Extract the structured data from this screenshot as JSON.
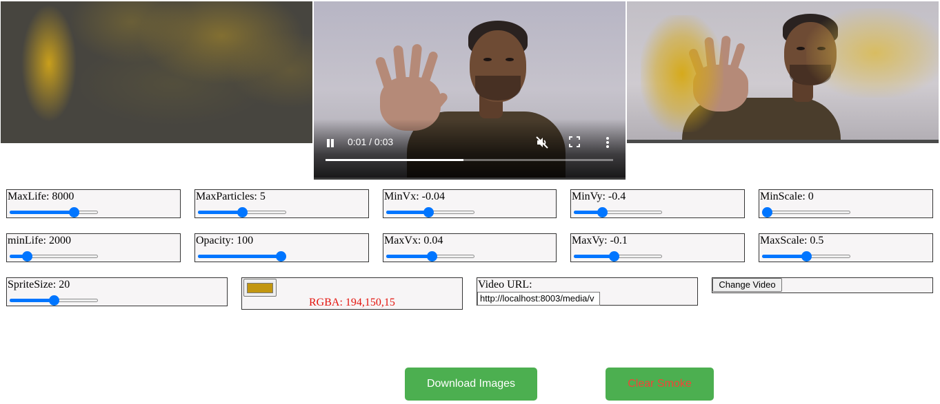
{
  "media": {
    "video": {
      "current_time": "0:01",
      "duration": "0:03",
      "time_separator": " / ",
      "progress": 0.48,
      "playing": true,
      "muted": true
    }
  },
  "controls": {
    "max_life": {
      "label": "MaxLife: ",
      "value": "8000",
      "level": 0.76
    },
    "max_particles": {
      "label": "MaxParticles: ",
      "value": "5",
      "level": 0.5
    },
    "min_vx": {
      "label": "MinVx: ",
      "value": "-0.04",
      "level": 0.48
    },
    "min_vy": {
      "label": "MinVy: ",
      "value": "-0.4",
      "level": 0.3
    },
    "min_scale": {
      "label": "MinScale: ",
      "value": "0",
      "level": 0.0
    },
    "min_life": {
      "label": "minLife: ",
      "value": "2000",
      "level": 0.16
    },
    "opacity": {
      "label": "Opacity: ",
      "value": "100",
      "level": 1.0
    },
    "max_vx": {
      "label": "MaxVx: ",
      "value": "0.04",
      "level": 0.52
    },
    "max_vy": {
      "label": "MaxVy: ",
      "value": "-0.1",
      "level": 0.45
    },
    "max_scale": {
      "label": "MaxScale: ",
      "value": "0.5",
      "level": 0.5
    },
    "sprite_size": {
      "label": "SpriteSize: ",
      "value": "20",
      "level": 0.5
    }
  },
  "color_picker": {
    "swatch_color": "#c2960f",
    "rgba_label": "RGBA: ",
    "rgba_value": "194,150,15"
  },
  "video_url": {
    "label": "Video URL:",
    "value": "http://localhost:8003/media/v"
  },
  "buttons": {
    "change_video": "Change Video",
    "download_images": "Download Images",
    "clear_smoke": "Clear Smoke"
  },
  "colors": {
    "accent": "#0075ff",
    "button_green": "#4caf50",
    "download_text": "#ffffff",
    "clear_text": "#f44336",
    "rgba_text": "#e3130c"
  },
  "icons": [
    "pause-icon",
    "mute-icon",
    "fullscreen-icon",
    "more-options-icon"
  ]
}
